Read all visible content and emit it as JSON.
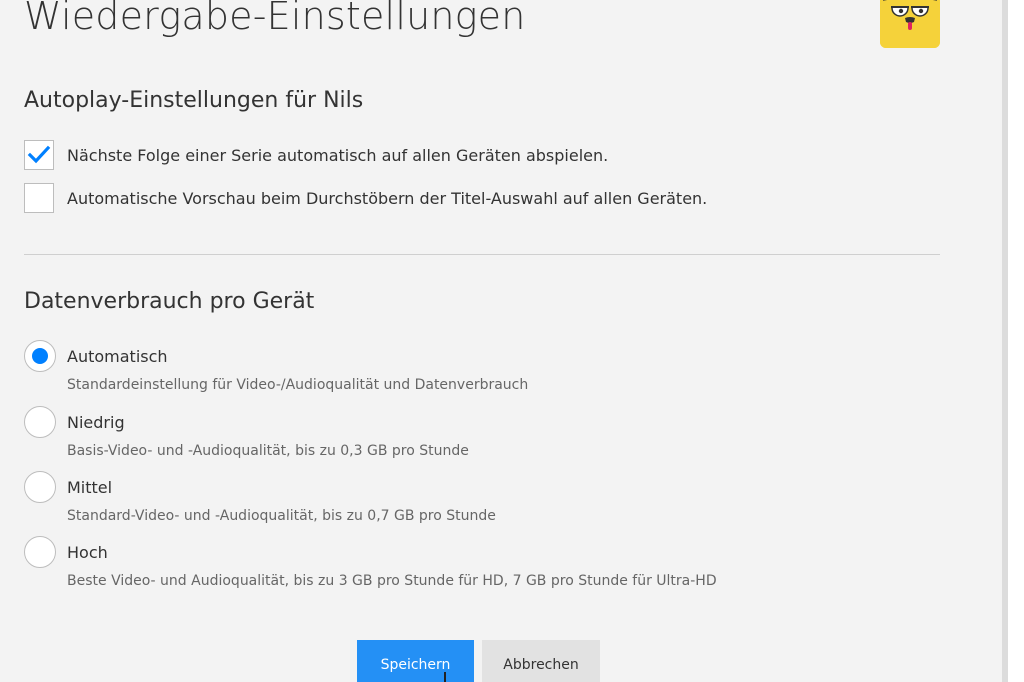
{
  "header": {
    "title": "Wiedergabe-Einstellungen",
    "avatar": "profile-avatar"
  },
  "autoplay": {
    "title": "Autoplay-Einstellungen für Nils",
    "options": [
      {
        "label": "Nächste Folge einer Serie automatisch auf allen Geräten abspielen.",
        "checked": true
      },
      {
        "label": "Automatische Vorschau beim Durchstöbern der Titel-Auswahl auf allen Geräten.",
        "checked": false
      }
    ]
  },
  "data_usage": {
    "title": "Datenverbrauch pro Gerät",
    "selected": "Automatisch",
    "options": [
      {
        "label": "Automatisch",
        "description": "Standardeinstellung für Video-/Audioqualität und Datenverbrauch"
      },
      {
        "label": "Niedrig",
        "description": "Basis-Video- und -Audioqualität, bis zu 0,3 GB pro Stunde"
      },
      {
        "label": "Mittel",
        "description": "Standard-Video- und -Audioqualität, bis zu 0,7 GB pro Stunde"
      },
      {
        "label": "Hoch",
        "description": "Beste Video- und Audioqualität, bis zu 3 GB pro Stunde für HD, 7 GB pro Stunde für Ultra-HD"
      }
    ]
  },
  "buttons": {
    "save": "Speichern",
    "cancel": "Abbrechen"
  },
  "colors": {
    "accent": "#0080ff",
    "primary_button": "#2490f5",
    "secondary_button": "#e2e2e2",
    "avatar_background": "#f5d23a",
    "page_background": "#f3f3f3"
  }
}
